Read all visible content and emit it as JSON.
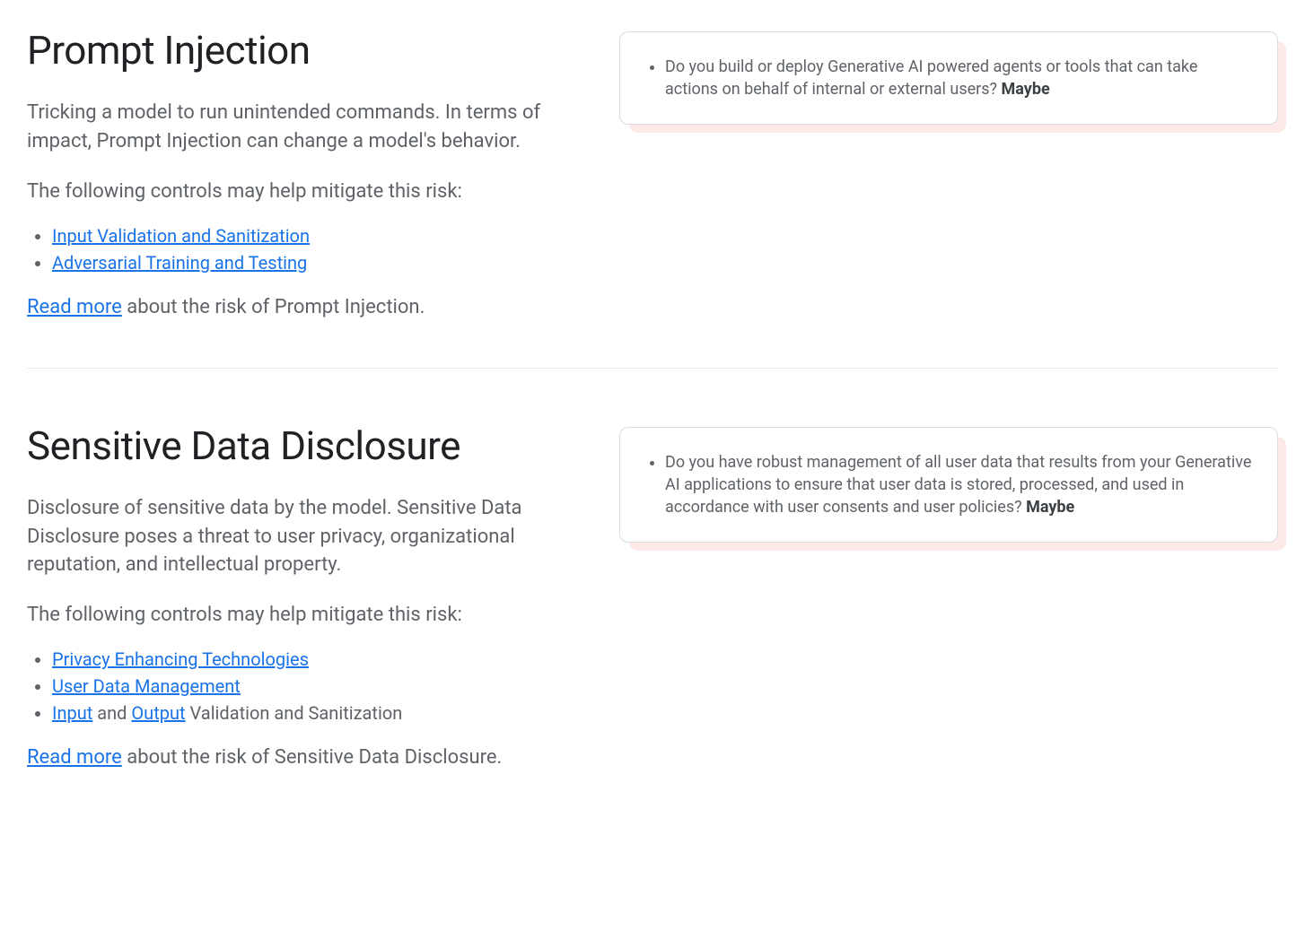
{
  "sections": [
    {
      "title": "Prompt Injection",
      "description": "Tricking a model to run unintended commands. In terms of impact, Prompt Injection can change a model's behavior.",
      "controls_intro": "The following controls may help mitigate this risk:",
      "controls": [
        {
          "label": "Input Validation and Sanitization",
          "link": true
        },
        {
          "label": "Adversarial Training and Testing",
          "link": true
        }
      ],
      "readmore_link": "Read more",
      "readmore_suffix": " about the risk of Prompt Injection.",
      "card_question": "Do you build or deploy Generative AI powered agents or tools that can take actions on behalf of internal or external users? ",
      "card_answer": "Maybe"
    },
    {
      "title": "Sensitive Data Disclosure",
      "description": "Disclosure of sensitive data by the model. Sensitive Data Disclosure poses a threat to user privacy, organizational reputation, and intellectual property.",
      "controls_intro": "The following controls may help mitigate this risk:",
      "controls": [
        {
          "label": "Privacy Enhancing Technologies",
          "link": true
        },
        {
          "label": "User Data Management",
          "link": true
        }
      ],
      "controls_mixed": {
        "link1": "Input",
        "mid1": " and ",
        "link2": "Output",
        "suffix": " Validation and Sanitization"
      },
      "readmore_link": "Read more",
      "readmore_suffix": " about the risk of Sensitive Data Disclosure.",
      "card_question": "Do you have robust management of all user data that results from your Generative AI applications to ensure that user data is stored, processed, and used in accordance with user consents and user policies? ",
      "card_answer": "Maybe"
    }
  ]
}
